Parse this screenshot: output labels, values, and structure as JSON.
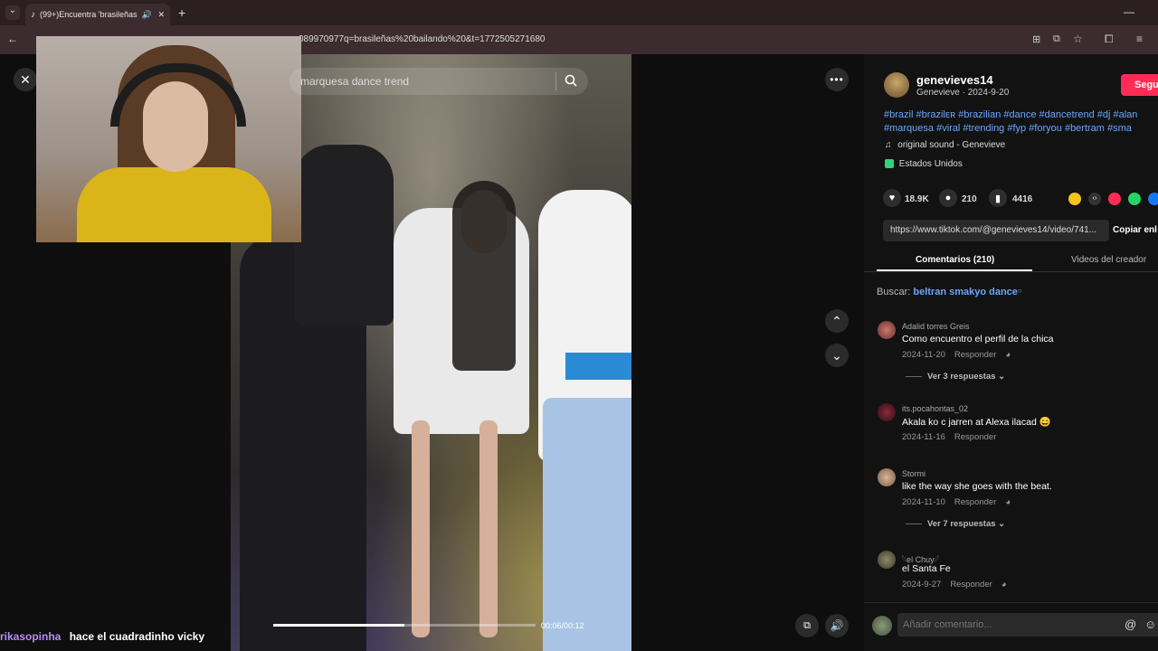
{
  "browser": {
    "tab_title": "(99+)Encuentra 'brasileñas",
    "url": "089970977q=brasileñas%20bailando%20&t=1772505271680"
  },
  "search": {
    "query": "marquesa dance trend"
  },
  "player": {
    "time": "00:06/00:12",
    "progress_fraction": 0.5
  },
  "chat": {
    "user": "rikasopinha",
    "message": "hace el cuadradinho vicky"
  },
  "creator": {
    "username": "genevieves14",
    "subline": "Genevieve · 2024-9-20",
    "follow_label": "Segu",
    "tags_line1": "#brazil #brazilᴇʀ #brazilian #dance #dancetrend #dj #alan",
    "tags_line2": "#marquesa #viral #trending #fyp #foryou #bertram #sma",
    "sound": "original sound - Genevieve",
    "location": "Estados Unidos"
  },
  "stats": {
    "likes": "18.9K",
    "comments": "210",
    "saves": "4416"
  },
  "link": {
    "url": "https://www.tiktok.com/@genevieves14/video/741...",
    "copy_label": "Copiar enl"
  },
  "tabs": {
    "comments": "Comentarios (210)",
    "creator_videos": "Videos del creador"
  },
  "buscar": {
    "label": "Buscar:",
    "query": "beltran smakyo dance"
  },
  "comments": [
    {
      "user": "Adalid torres Greis",
      "text": "Como encuentro el perfil de la chica",
      "date": "2024-11-20",
      "reply": "Responder",
      "replies": "Ver 3 respuestas"
    },
    {
      "user": "its.pocahontas_02",
      "text": "Akala ko c jarren at Alexa ilacad 😄",
      "date": "2024-11-16",
      "reply": "Responder",
      "replies": ""
    },
    {
      "user": "Stormi",
      "text": "like the way she goes with the beat.",
      "date": "2024-11-10",
      "reply": "Responder",
      "replies": "Ver 7 respuestas"
    },
    {
      "user": "𓆩el Chuy𓆪",
      "text": "el Santa Fe",
      "date": "2024-9-27",
      "reply": "Responder",
      "replies": ""
    }
  ],
  "comment_input": {
    "placeholder": "Añadir comentario..."
  },
  "colors": {
    "accent": "#fe2c55",
    "link": "#6aa6ff",
    "chat_user": "#b98cf5"
  }
}
